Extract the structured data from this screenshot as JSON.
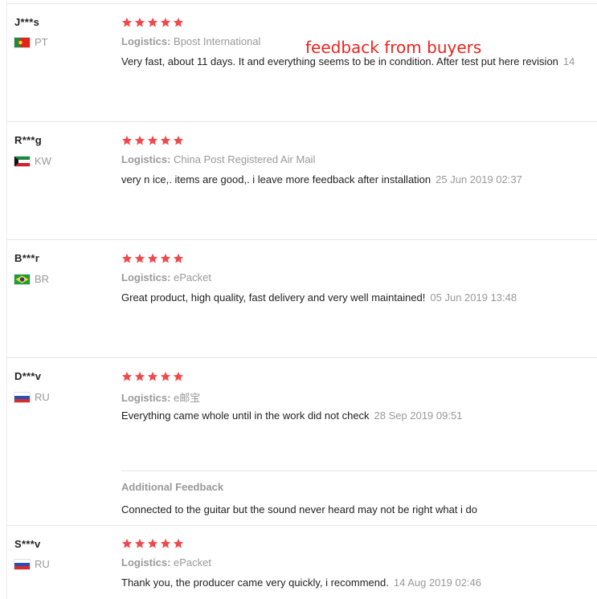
{
  "annotation": "feedback from buyers",
  "logistics_label": "Logistics:",
  "reviews": [
    {
      "user": "J***s",
      "country": "PT",
      "stars": 5,
      "logistics": "Bpost International",
      "text": "Very fast, about 11 days. It and everything seems to be in condition. After test put here revision",
      "date": "14"
    },
    {
      "user": "R***g",
      "country": "KW",
      "stars": 5,
      "logistics": "China Post Registered Air Mail",
      "text": "very n ice,. items are good,. i leave more feedback after installation",
      "date": "25 Jun 2019 02:37"
    },
    {
      "user": "B***r",
      "country": "BR",
      "stars": 5,
      "logistics": "ePacket",
      "text": "Great product, high quality, fast delivery and very well maintained!",
      "date": "05 Jun 2019 13:48"
    },
    {
      "user": "D***v",
      "country": "RU",
      "stars": 5,
      "logistics": "e邮宝",
      "text": "Everything came whole until in the work did not check",
      "date": "28 Sep 2019 09:51",
      "additional_title": "Additional Feedback",
      "additional_text": "Connected to the guitar but the sound never heard may not be right what i do"
    },
    {
      "user": "S***v",
      "country": "RU",
      "stars": 5,
      "logistics": "ePacket",
      "text": "Thank you, the producer came very quickly, i recommend.",
      "date": "14 Aug 2019 02:46"
    }
  ],
  "colors": {
    "star": "#f2484b",
    "annotation": "#e8251f",
    "muted": "#999999"
  }
}
